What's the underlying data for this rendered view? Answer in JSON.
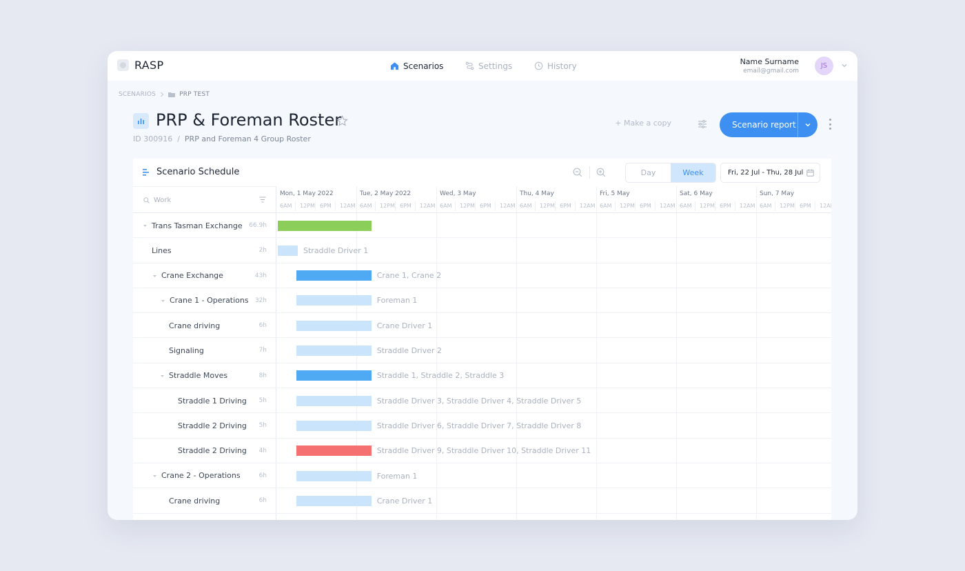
{
  "app": {
    "brand": "RASP"
  },
  "nav": [
    {
      "label": "Scenarios",
      "icon": "home-icon",
      "active": true
    },
    {
      "label": "Settings",
      "icon": "route-icon",
      "active": false
    },
    {
      "label": "History",
      "icon": "clock-icon",
      "active": false
    }
  ],
  "user": {
    "name": "Name Surname",
    "email": "email@gmail.com",
    "initials": "JS"
  },
  "breadcrumb": {
    "root": "SCENARIOS",
    "current": "PRP TEST"
  },
  "page": {
    "title": "PRP & Foreman Roster",
    "id": "ID 300916",
    "description": "PRP and Foreman 4 Group Roster",
    "make_copy": "+ Make a copy",
    "report_button": "Scenario report"
  },
  "schedule": {
    "title": "Scenario Schedule",
    "view_day": "Day",
    "view_week": "Week",
    "active_view": "Week",
    "date_range": "Fri, 22 Jul - Thu, 28 Jul",
    "search_placeholder": "Work",
    "days": [
      "Mon, 1 May 2022",
      "Tue, 2 May 2022",
      "Wed, 3 May",
      "Thu, 4 May",
      "Fri, 5 May",
      "Sat, 6 May",
      "Sun, 7 May"
    ],
    "hours": [
      "6AM",
      "12PM",
      "6PM",
      "12AM"
    ],
    "colors": {
      "green": "#8bcf5a",
      "blue": "#4faaf3",
      "light": "#c9e4fb",
      "red": "#f57070"
    },
    "rows": [
      {
        "name": "Trans Tasman Exchange",
        "hours": "66.9h",
        "level": 0,
        "caret": true,
        "bar_start": 0.0,
        "bar_end": 1.17,
        "color": "green",
        "label": ""
      },
      {
        "name": "Lines",
        "hours": "2h",
        "level": 0,
        "caret": false,
        "bar_start": 0.0,
        "bar_end": 0.25,
        "color": "light",
        "label": "Straddle Driver 1"
      },
      {
        "name": "Crane Exchange",
        "hours": "43h",
        "level": 1,
        "caret": true,
        "bar_start": 0.23,
        "bar_end": 1.17,
        "color": "blue",
        "label": "Crane 1, Crane 2"
      },
      {
        "name": "Crane 1 - Operations",
        "hours": "32h",
        "level": 2,
        "caret": true,
        "bar_start": 0.23,
        "bar_end": 1.17,
        "color": "light",
        "label": "Foreman 1"
      },
      {
        "name": "Crane driving",
        "hours": "6h",
        "level": 3,
        "caret": false,
        "bar_start": 0.23,
        "bar_end": 1.17,
        "color": "light",
        "label": "Crane Driver 1"
      },
      {
        "name": "Signaling",
        "hours": "7h",
        "level": 3,
        "caret": false,
        "bar_start": 0.23,
        "bar_end": 1.17,
        "color": "light",
        "label": "Straddle Driver 2"
      },
      {
        "name": "Straddle Moves",
        "hours": "8h",
        "level": 3,
        "caret": true,
        "bar_start": 0.23,
        "bar_end": 1.17,
        "color": "blue",
        "label": "Straddle 1, Straddle 2, Straddle 3"
      },
      {
        "name": "Straddle 1 Driving",
        "hours": "5h",
        "level": 4,
        "caret": false,
        "bar_start": 0.23,
        "bar_end": 1.17,
        "color": "light",
        "label": "Straddle Driver 3, Straddle Driver 4, Straddle Driver 5"
      },
      {
        "name": "Straddle 2 Driving",
        "hours": "5h",
        "level": 4,
        "caret": false,
        "bar_start": 0.23,
        "bar_end": 1.17,
        "color": "light",
        "label": "Straddle Driver 6, Straddle Driver 7, Straddle Driver 8"
      },
      {
        "name": "Straddle 2 Driving",
        "hours": "4h",
        "level": 4,
        "caret": false,
        "bar_start": 0.23,
        "bar_end": 1.17,
        "color": "red",
        "label": "Straddle Driver 9, Straddle Driver 10, Straddle Driver 11"
      },
      {
        "name": "Crane 2 - Operations",
        "hours": "6h",
        "level": 1,
        "caret": true,
        "bar_start": 0.23,
        "bar_end": 1.17,
        "color": "light",
        "label": "Foreman 1"
      },
      {
        "name": "Crane driving",
        "hours": "6h",
        "level": 3,
        "caret": false,
        "bar_start": 0.23,
        "bar_end": 1.17,
        "color": "light",
        "label": "Crane Driver 1"
      },
      {
        "name": "",
        "hours": "",
        "level": 0,
        "caret": false,
        "bar_start": 0.23,
        "bar_end": 1.17,
        "color": "light",
        "label": ""
      }
    ]
  }
}
